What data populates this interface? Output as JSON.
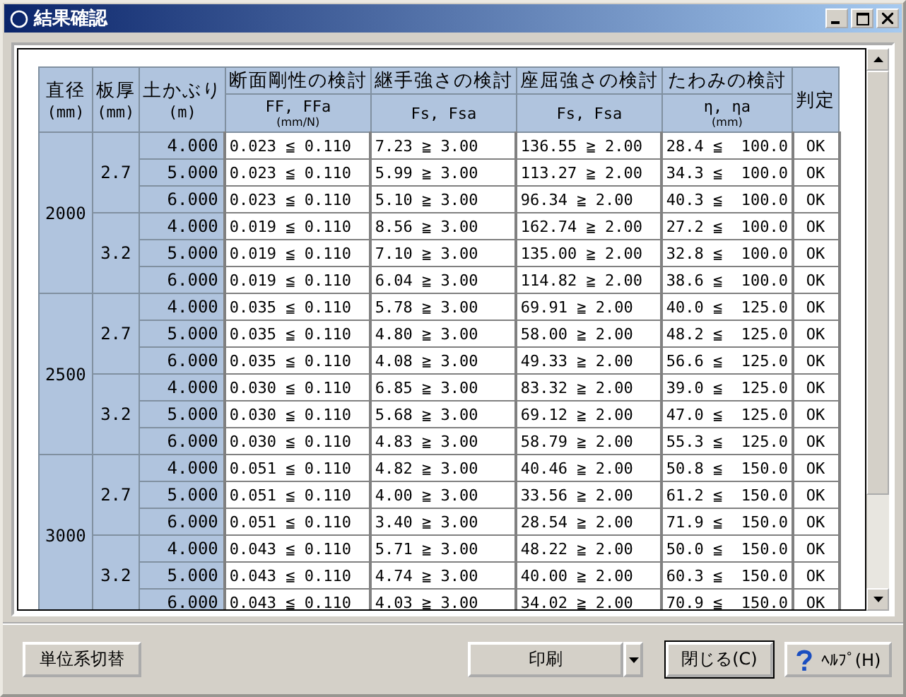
{
  "window": {
    "title": "結果確認"
  },
  "table": {
    "headers": [
      {
        "label": "直径",
        "unit": "(mm)"
      },
      {
        "label": "板厚",
        "unit": "(mm)"
      },
      {
        "label": "土かぶり",
        "unit": "(m)"
      }
    ],
    "checks": [
      {
        "label": "断面剛性の検討",
        "sub": "FF, FFa",
        "unit": "(mm/N)"
      },
      {
        "label": "継手強さの検討",
        "sub": "Fs, Fsa"
      },
      {
        "label": "座屈強さの検討",
        "sub": "Fs, Fsa"
      },
      {
        "label": "たわみの検討",
        "sub": "η, ηa",
        "unit": "(mm)"
      }
    ],
    "judge_header": "判定",
    "groups": [
      {
        "diameter": "2000",
        "children": [
          {
            "thickness": "2.7",
            "rows": [
              [
                "4.000",
                "0.023 ≦ 0.110",
                "7.23 ≧ 3.00",
                "136.55 ≧ 2.00",
                "28.4 ≦  100.0",
                "OK"
              ],
              [
                "5.000",
                "0.023 ≦ 0.110",
                "5.99 ≧ 3.00",
                "113.27 ≧ 2.00",
                "34.3 ≦  100.0",
                "OK"
              ],
              [
                "6.000",
                "0.023 ≦ 0.110",
                "5.10 ≧ 3.00",
                "96.34 ≧ 2.00",
                "40.3 ≦  100.0",
                "OK"
              ]
            ]
          },
          {
            "thickness": "3.2",
            "rows": [
              [
                "4.000",
                "0.019 ≦ 0.110",
                "8.56 ≧ 3.00",
                "162.74 ≧ 2.00",
                "27.2 ≦  100.0",
                "OK"
              ],
              [
                "5.000",
                "0.019 ≦ 0.110",
                "7.10 ≧ 3.00",
                "135.00 ≧ 2.00",
                "32.8 ≦  100.0",
                "OK"
              ],
              [
                "6.000",
                "0.019 ≦ 0.110",
                "6.04 ≧ 3.00",
                "114.82 ≧ 2.00",
                "38.6 ≦  100.0",
                "OK"
              ]
            ]
          }
        ]
      },
      {
        "diameter": "2500",
        "children": [
          {
            "thickness": "2.7",
            "rows": [
              [
                "4.000",
                "0.035 ≦ 0.110",
                "5.78 ≧ 3.00",
                "69.91 ≧ 2.00",
                "40.0 ≦  125.0",
                "OK"
              ],
              [
                "5.000",
                "0.035 ≦ 0.110",
                "4.80 ≧ 3.00",
                "58.00 ≧ 2.00",
                "48.2 ≦  125.0",
                "OK"
              ],
              [
                "6.000",
                "0.035 ≦ 0.110",
                "4.08 ≧ 3.00",
                "49.33 ≧ 2.00",
                "56.6 ≦  125.0",
                "OK"
              ]
            ]
          },
          {
            "thickness": "3.2",
            "rows": [
              [
                "4.000",
                "0.030 ≦ 0.110",
                "6.85 ≧ 3.00",
                "83.32 ≧ 2.00",
                "39.0 ≦  125.0",
                "OK"
              ],
              [
                "5.000",
                "0.030 ≦ 0.110",
                "5.68 ≧ 3.00",
                "69.12 ≧ 2.00",
                "47.0 ≦  125.0",
                "OK"
              ],
              [
                "6.000",
                "0.030 ≦ 0.110",
                "4.83 ≧ 3.00",
                "58.79 ≧ 2.00",
                "55.3 ≦  125.0",
                "OK"
              ]
            ]
          }
        ]
      },
      {
        "diameter": "3000",
        "children": [
          {
            "thickness": "2.7",
            "rows": [
              [
                "4.000",
                "0.051 ≦ 0.110",
                "4.82 ≧ 3.00",
                "40.46 ≧ 2.00",
                "50.8 ≦  150.0",
                "OK"
              ],
              [
                "5.000",
                "0.051 ≦ 0.110",
                "4.00 ≧ 3.00",
                "33.56 ≧ 2.00",
                "61.2 ≦  150.0",
                "OK"
              ],
              [
                "6.000",
                "0.051 ≦ 0.110",
                "3.40 ≧ 3.00",
                "28.54 ≧ 2.00",
                "71.9 ≦  150.0",
                "OK"
              ]
            ]
          },
          {
            "thickness": "3.2",
            "rows": [
              [
                "4.000",
                "0.043 ≦ 0.110",
                "5.71 ≧ 3.00",
                "48.22 ≧ 2.00",
                "50.0 ≦  150.0",
                "OK"
              ],
              [
                "5.000",
                "0.043 ≦ 0.110",
                "4.74 ≧ 3.00",
                "40.00 ≧ 2.00",
                "60.3 ≦  150.0",
                "OK"
              ],
              [
                "6.000",
                "0.043 ≦ 0.110",
                "4.03 ≧ 3.00",
                "34.02 ≧ 2.00",
                "70.9 ≦  150.0",
                "OK"
              ]
            ]
          }
        ]
      }
    ]
  },
  "buttons": {
    "units": "単位系切替",
    "print": "印刷",
    "close": "閉じる(C)",
    "help": "ﾍﾙﾌﾟ(H)"
  }
}
